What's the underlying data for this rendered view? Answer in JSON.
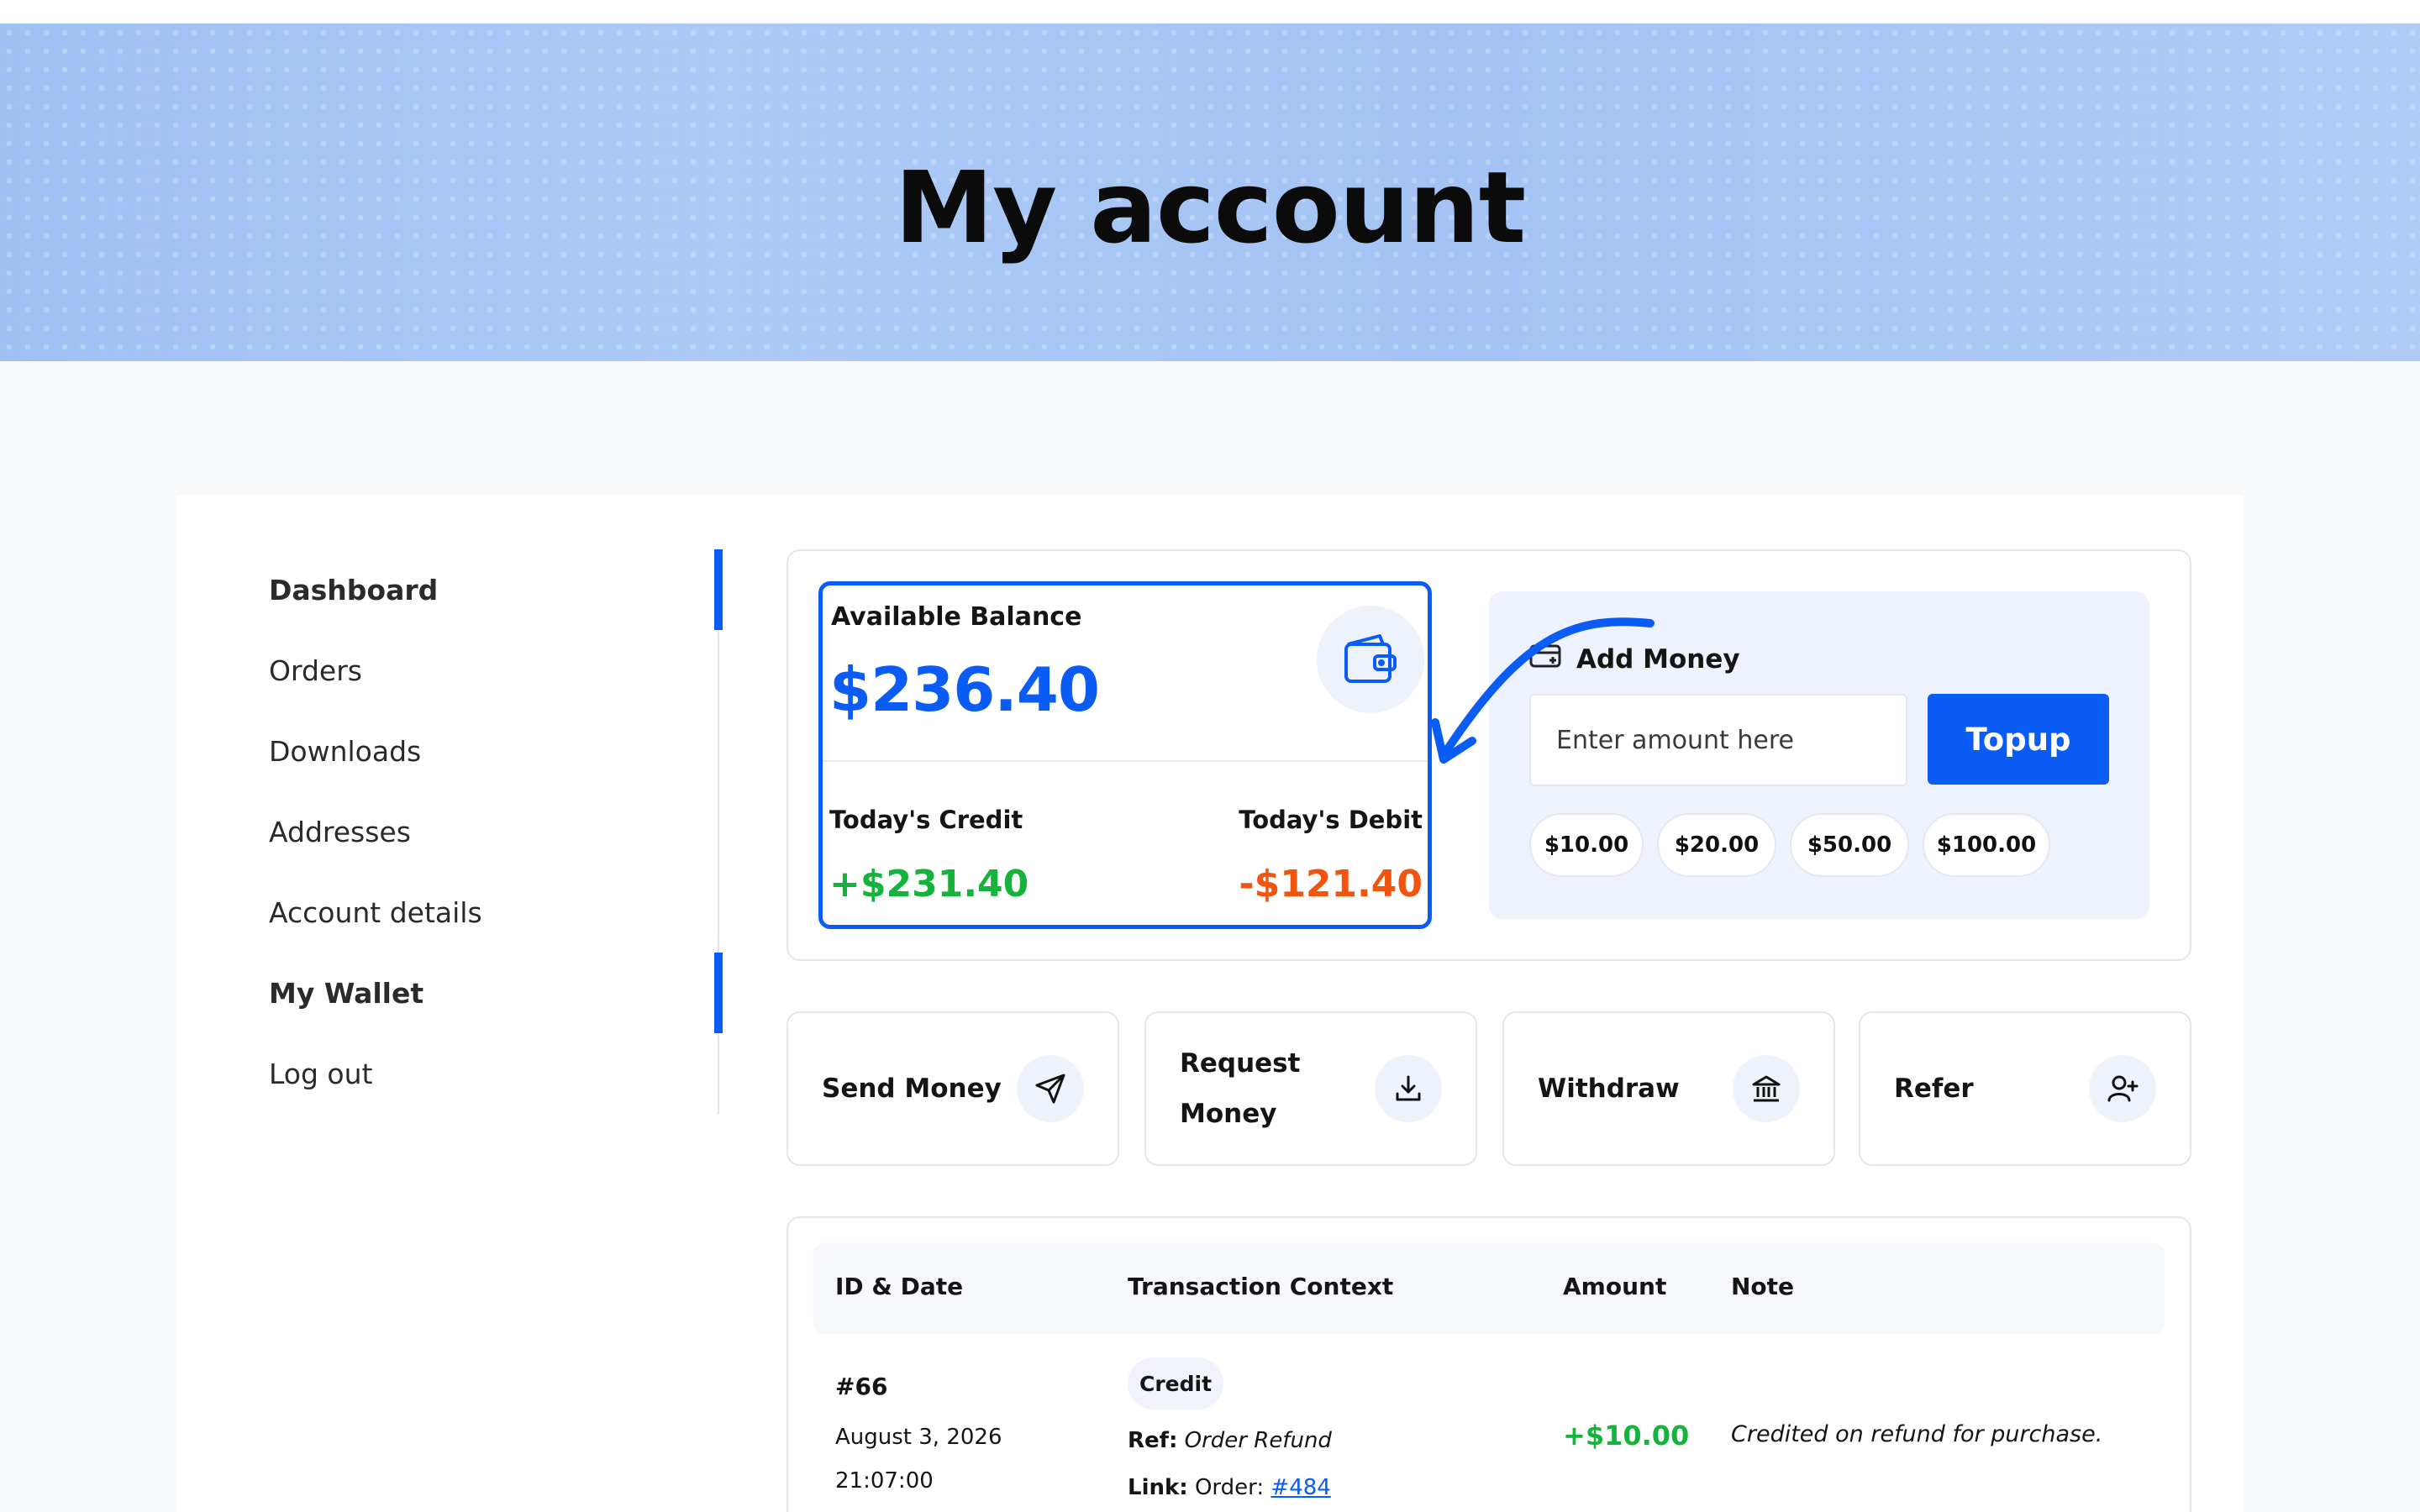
{
  "page": {
    "title": "My account"
  },
  "sidebar": {
    "items": [
      {
        "label": "Dashboard",
        "active": true
      },
      {
        "label": "Orders",
        "active": false
      },
      {
        "label": "Downloads",
        "active": false
      },
      {
        "label": "Addresses",
        "active": false
      },
      {
        "label": "Account details",
        "active": false
      },
      {
        "label": "My Wallet",
        "active": true
      },
      {
        "label": "Log out",
        "active": false
      }
    ]
  },
  "balance": {
    "label": "Available Balance",
    "amount": "$236.40",
    "credit_label": "Today's Credit",
    "credit_value": "+$231.40",
    "debit_label": "Today's Debit",
    "debit_value": "-$121.40",
    "icon": "wallet-icon"
  },
  "add_money": {
    "title": "Add Money",
    "icon": "card-add-icon",
    "input_placeholder": "Enter amount here",
    "button_label": "Topup",
    "presets": [
      "$10.00",
      "$20.00",
      "$50.00",
      "$100.00"
    ]
  },
  "actions": [
    {
      "label": "Send Money",
      "icon": "send-icon"
    },
    {
      "label_line1": "Request",
      "label_line2": "Money",
      "icon": "download-icon"
    },
    {
      "label": "Withdraw",
      "icon": "bank-icon"
    },
    {
      "label": "Refer",
      "icon": "user-plus-icon"
    }
  ],
  "table": {
    "headers": [
      "ID & Date",
      "Transaction Context",
      "Amount",
      "Note"
    ],
    "rows": [
      {
        "id": "#66",
        "date": "August 3, 2026",
        "time": "21:07:00",
        "type": "Credit",
        "ref_label": "Ref:",
        "ref_value": "Order Refund",
        "link_label": "Link:",
        "link_prefix": "Order:",
        "link_value": "#484",
        "amount": "+$10.00",
        "note": "Credited on refund for purchase."
      }
    ]
  },
  "colors": {
    "accent": "#0b5bf5",
    "credit": "#16b33c",
    "debit": "#f0540f",
    "hero": "#a9c7f5"
  }
}
